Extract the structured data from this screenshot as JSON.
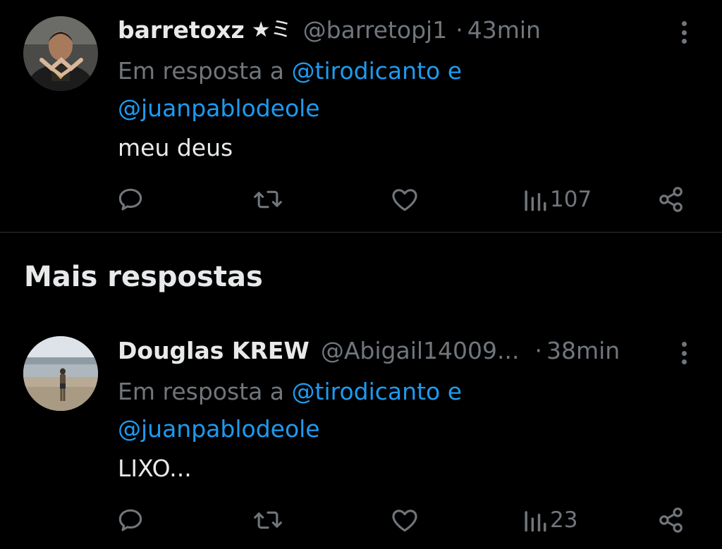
{
  "tweets": [
    {
      "name": "barretoxz",
      "badge": "★ミ",
      "handle": "@barretopj1",
      "separator": "·",
      "time": "43min",
      "reply_prefix": "Em resposta a",
      "mention_1": "@tirodicanto",
      "conjunction": "e",
      "mention_2": "@juanpablodeole",
      "text": "meu deus",
      "views": "107"
    },
    {
      "name": "Douglas KREW",
      "handle": "@Abigail14009...",
      "separator": "·",
      "time": "38min",
      "reply_prefix": "Em resposta a",
      "mention_1": "@tirodicanto",
      "conjunction": "e",
      "mention_2": "@juanpablodeole",
      "text": "LIXO...",
      "views": "23"
    }
  ],
  "section": {
    "title": "Mais respostas"
  },
  "icons": {
    "reply": "reply-icon",
    "retweet": "retweet-icon",
    "like": "heart-icon",
    "views": "views-icon",
    "share": "share-icon",
    "more": "more-vertical-icon"
  },
  "colors": {
    "background": "#000000",
    "text": "#e7e9ea",
    "secondary": "#71767b",
    "mention": "#1d9bf0",
    "divider": "#2f3336"
  }
}
